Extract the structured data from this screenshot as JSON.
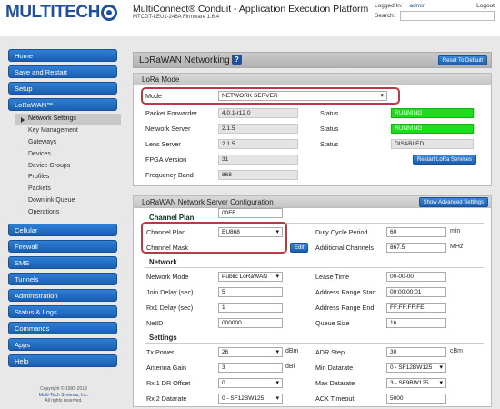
{
  "header": {
    "brand": "MULTITECH",
    "app_title": "MultiConnect® Conduit - Application Execution Platform",
    "app_sub": "MTCDT-LEU1-246A   Firmware 1.6.4",
    "logged_in_label": "Logged In:",
    "logged_in_user": "admin",
    "logout_label": "Logout",
    "search_label": "Search:"
  },
  "sidebar": {
    "top_items": [
      {
        "label": "Home"
      },
      {
        "label": "Save and Restart"
      },
      {
        "label": "Setup"
      },
      {
        "label": "LoRaWAN™"
      }
    ],
    "lora_sub_items": [
      {
        "label": "Network Settings"
      },
      {
        "label": "Key Management"
      },
      {
        "label": "Gateways"
      },
      {
        "label": "Devices"
      },
      {
        "label": "Device Groups"
      },
      {
        "label": "Profiles"
      },
      {
        "label": "Packets"
      },
      {
        "label": "Downlink Queue"
      },
      {
        "label": "Operations"
      }
    ],
    "bottom_items": [
      {
        "label": "Cellular"
      },
      {
        "label": "Firewall"
      },
      {
        "label": "SMS"
      },
      {
        "label": "Tunnels"
      },
      {
        "label": "Administration"
      },
      {
        "label": "Status & Logs"
      },
      {
        "label": "Commands"
      },
      {
        "label": "Apps"
      },
      {
        "label": "Help"
      }
    ],
    "copyright_line1": "Copyright © 1995-2019",
    "copyright_line2": "Multi-Tech Systems, Inc.",
    "copyright_line3": "All rights reserved."
  },
  "page": {
    "title": "LoRaWAN Networking",
    "help_icon": "?",
    "reset_button": "Reset To Default"
  },
  "lora_mode": {
    "header": "LoRa Mode",
    "mode_label": "Mode",
    "mode_value": "NETWORK SERVER",
    "packet_forwarder_label": "Packet Forwarder",
    "packet_forwarder_value": "4.0.1-r12.0",
    "network_server_label": "Network Server",
    "network_server_value": "2.1.5",
    "lens_server_label": "Lens Server",
    "lens_server_value": "2.1.5",
    "fpga_label": "FPGA Version",
    "fpga_value": "31",
    "freq_band_label": "Frequency Band",
    "freq_band_value": "868",
    "status_label": "Status",
    "status1": "RUNNING",
    "status2": "RUNNING",
    "status3": "DISABLED",
    "restart_button": "Restart LoRa Services"
  },
  "ns_config": {
    "header": "LoRaWAN Network Server Configuration",
    "advanced_button": "Show Advanced Settings",
    "channel_plan_section": "Channel Plan",
    "channel_plan_label": "Channel Plan",
    "channel_plan_value": "EU868",
    "channel_mask_label": "Channel Mask",
    "channel_mask_value": "00FF",
    "edit_button": "Edit",
    "duty_cycle_label": "Duty Cycle Period",
    "duty_cycle_value": "60",
    "duty_cycle_unit": "min",
    "additional_channels_label": "Additional Channels",
    "additional_channels_value": "867.5",
    "additional_channels_unit": "MHz",
    "network_section": "Network",
    "network_mode_label": "Network Mode",
    "network_mode_value": "Public LoRaWAN",
    "join_delay_label": "Join Delay (sec)",
    "join_delay_value": "5",
    "rx1_delay_label": "Rx1 Delay (sec)",
    "rx1_delay_value": "1",
    "netid_label": "NetID",
    "netid_value": "000000",
    "lease_time_label": "Lease Time",
    "lease_time_value": "00-00-00",
    "addr_start_label": "Address Range Start",
    "addr_start_value": "00:00:00:01",
    "addr_end_label": "Address Range End",
    "addr_end_value": "FF:FF:FF:FE",
    "queue_size_label": "Queue Size",
    "queue_size_value": "16",
    "settings_section": "Settings",
    "tx_power_label": "Tx Power",
    "tx_power_value": "26",
    "tx_power_unit": "dBm",
    "antenna_gain_label": "Antenna Gain",
    "antenna_gain_value": "3",
    "antenna_gain_unit": "dBi",
    "rx1_dr_offset_label": "Rx 1 DR Offset",
    "rx1_dr_offset_value": "0",
    "rx2_datarate_label": "Rx 2 Datarate",
    "rx2_datarate_value": "0 - SF12BW125",
    "adr_step_label": "ADR Step",
    "adr_step_value": "30",
    "adr_step_unit": "cBm",
    "min_datarate_label": "Min Datarate",
    "min_datarate_value": "0 - SF12BW125",
    "max_datarate_label": "Max Datarate",
    "max_datarate_value": "3 - SF9BW125",
    "ack_timeout_label": "ACK Timeout",
    "ack_timeout_value": "5000"
  },
  "colors": {
    "brand_blue": "#1f4fa0",
    "nav_blue": "#1a5fb0",
    "running_green": "#1ddc1d",
    "highlight_red": "#b83a48"
  }
}
